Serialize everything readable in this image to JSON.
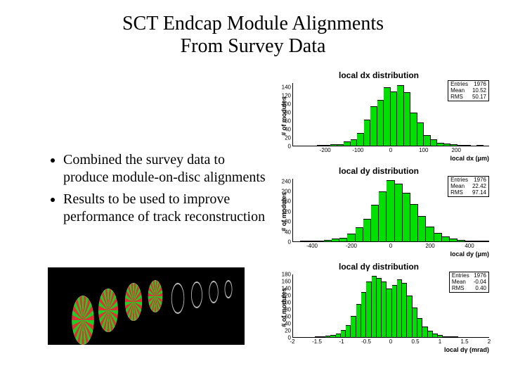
{
  "title_line1": "SCT Endcap Module Alignments",
  "title_line2": "From Survey Data",
  "bullets": [
    "Combined the survey data to produce module-on-disc alignments",
    "Results to be used to improve performance of track reconstruction"
  ],
  "charts": [
    {
      "title": "local dx distribution",
      "ylabel": "# of modules",
      "xlabel": "local dx (μm)",
      "stats": {
        "entries": "1976",
        "mean": "10.52",
        "rms": "50.17"
      },
      "xticks": [
        {
          "pos": 0.167,
          "label": "-200"
        },
        {
          "pos": 0.333,
          "label": "-100"
        },
        {
          "pos": 0.5,
          "label": "0"
        },
        {
          "pos": 0.667,
          "label": "100"
        },
        {
          "pos": 0.833,
          "label": "200"
        }
      ],
      "yticks": [
        {
          "pos": 0.0,
          "label": "0"
        },
        {
          "pos": 0.133,
          "label": "20"
        },
        {
          "pos": 0.267,
          "label": "40"
        },
        {
          "pos": 0.4,
          "label": "60"
        },
        {
          "pos": 0.533,
          "label": "80"
        },
        {
          "pos": 0.667,
          "label": "100"
        },
        {
          "pos": 0.8,
          "label": "120"
        },
        {
          "pos": 0.933,
          "label": "140"
        }
      ],
      "ymax": 150
    },
    {
      "title": "local dy distribution",
      "ylabel": "# of modules",
      "xlabel": "local dy (μm)",
      "stats": {
        "entries": "1976",
        "mean": "22.42",
        "rms": "97.14"
      },
      "xticks": [
        {
          "pos": 0.1,
          "label": "-400"
        },
        {
          "pos": 0.3,
          "label": "-200"
        },
        {
          "pos": 0.5,
          "label": "0"
        },
        {
          "pos": 0.7,
          "label": "200"
        },
        {
          "pos": 0.9,
          "label": "400"
        }
      ],
      "yticks": [
        {
          "pos": 0.0,
          "label": "0"
        },
        {
          "pos": 0.16,
          "label": "40"
        },
        {
          "pos": 0.32,
          "label": "80"
        },
        {
          "pos": 0.48,
          "label": "120"
        },
        {
          "pos": 0.64,
          "label": "160"
        },
        {
          "pos": 0.8,
          "label": "200"
        },
        {
          "pos": 0.96,
          "label": "240"
        }
      ],
      "ymax": 250
    },
    {
      "title": "local dγ distribution",
      "ylabel": "# of modules",
      "xlabel": "local dγ (mrad)",
      "stats": {
        "entries": "1976",
        "mean": "-0.04",
        "rms": "0.40"
      },
      "xticks": [
        {
          "pos": 0.0,
          "label": "-2"
        },
        {
          "pos": 0.125,
          "label": "-1.5"
        },
        {
          "pos": 0.25,
          "label": "-1"
        },
        {
          "pos": 0.375,
          "label": "-0.5"
        },
        {
          "pos": 0.5,
          "label": "0"
        },
        {
          "pos": 0.625,
          "label": "0.5"
        },
        {
          "pos": 0.75,
          "label": "1"
        },
        {
          "pos": 0.875,
          "label": "1.5"
        },
        {
          "pos": 1.0,
          "label": "2"
        }
      ],
      "yticks": [
        {
          "pos": 0.0,
          "label": "0"
        },
        {
          "pos": 0.111,
          "label": "20"
        },
        {
          "pos": 0.222,
          "label": "40"
        },
        {
          "pos": 0.333,
          "label": "60"
        },
        {
          "pos": 0.444,
          "label": "80"
        },
        {
          "pos": 0.556,
          "label": "100"
        },
        {
          "pos": 0.667,
          "label": "120"
        },
        {
          "pos": 0.778,
          "label": "140"
        },
        {
          "pos": 0.889,
          "label": "160"
        },
        {
          "pos": 1.0,
          "label": "180"
        }
      ],
      "ymax": 180
    }
  ],
  "chart_data": [
    {
      "type": "bar",
      "title": "local dx distribution",
      "xlabel": "local dx (μm)",
      "ylabel": "# of modules",
      "xlim": [
        -300,
        300
      ],
      "ylim": [
        0,
        150
      ],
      "bin_edges": [
        -300,
        -280,
        -260,
        -240,
        -220,
        -200,
        -180,
        -160,
        -140,
        -120,
        -100,
        -80,
        -60,
        -40,
        -20,
        0,
        20,
        40,
        60,
        80,
        100,
        120,
        140,
        160,
        180,
        200,
        220,
        240,
        260,
        280,
        300
      ],
      "values": [
        0,
        0,
        0,
        0,
        1,
        2,
        3,
        4,
        10,
        15,
        30,
        62,
        95,
        110,
        140,
        130,
        145,
        128,
        80,
        55,
        25,
        15,
        6,
        5,
        4,
        2,
        2,
        0,
        1,
        0
      ]
    },
    {
      "type": "bar",
      "title": "local dy distribution",
      "xlabel": "local dy (μm)",
      "ylabel": "# of modules",
      "xlim": [
        -500,
        500
      ],
      "ylim": [
        0,
        250
      ],
      "bin_edges": [
        -500,
        -460,
        -420,
        -380,
        -340,
        -300,
        -260,
        -220,
        -180,
        -140,
        -100,
        -60,
        -20,
        20,
        60,
        100,
        140,
        180,
        220,
        260,
        300,
        340,
        380,
        420,
        460,
        500
      ],
      "values": [
        0,
        1,
        1,
        3,
        5,
        10,
        15,
        30,
        55,
        90,
        145,
        200,
        245,
        230,
        195,
        150,
        100,
        60,
        35,
        20,
        12,
        6,
        4,
        2,
        1
      ]
    },
    {
      "type": "bar",
      "title": "local dγ distribution",
      "xlabel": "local dγ (mrad)",
      "ylabel": "# of modules",
      "xlim": [
        -2,
        2
      ],
      "ylim": [
        0,
        180
      ],
      "bin_edges": [
        -2.0,
        -1.9,
        -1.8,
        -1.7,
        -1.6,
        -1.5,
        -1.4,
        -1.3,
        -1.2,
        -1.1,
        -1.0,
        -0.9,
        -0.8,
        -0.7,
        -0.6,
        -0.5,
        -0.4,
        -0.3,
        -0.2,
        -0.1,
        0.0,
        0.1,
        0.2,
        0.3,
        0.4,
        0.5,
        0.6,
        0.7,
        0.8,
        0.9,
        1.0,
        1.1,
        1.2,
        1.3,
        1.4,
        1.5,
        1.6,
        1.7,
        1.8,
        1.9,
        2.0
      ],
      "values": [
        0,
        0,
        0,
        0,
        0,
        1,
        2,
        4,
        6,
        10,
        20,
        35,
        60,
        95,
        130,
        160,
        175,
        170,
        160,
        140,
        150,
        165,
        155,
        120,
        85,
        55,
        30,
        18,
        10,
        6,
        3,
        2,
        1,
        0,
        0,
        0,
        0,
        0,
        0,
        0
      ]
    }
  ]
}
